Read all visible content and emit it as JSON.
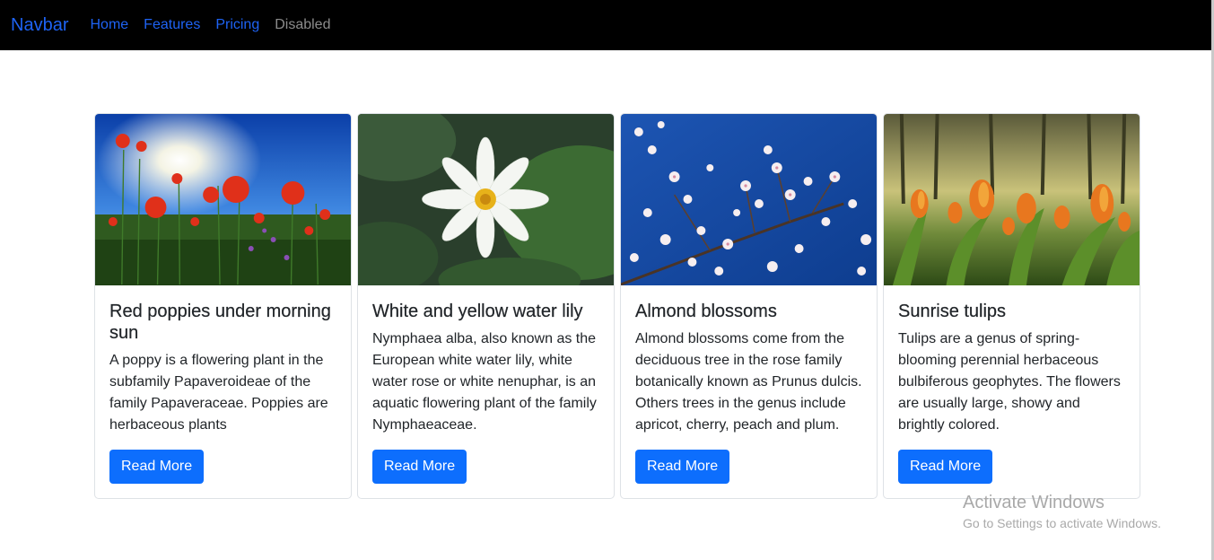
{
  "navbar": {
    "brand": "Navbar",
    "links": [
      "Home",
      "Features",
      "Pricing"
    ],
    "disabled_link": "Disabled"
  },
  "cards": [
    {
      "title": "Red poppies under morning sun",
      "text": "A poppy is a flowering plant in the subfamily Papaveroideae of the family Papaveraceae. Poppies are herbaceous plants",
      "button": "Read More"
    },
    {
      "title": "White and yellow water lily",
      "text": "Nymphaea alba, also known as the European white water lily, white water rose or white nenuphar, is an aquatic flowering plant of the family Nymphaeaceae.",
      "button": "Read More"
    },
    {
      "title": "Almond blossoms",
      "text": "Almond blossoms come from the deciduous tree in the rose family botanically known as Prunus dulcis. Others trees in the genus include apricot, cherry, peach and plum.",
      "button": "Read More"
    },
    {
      "title": "Sunrise tulips",
      "text": "Tulips are a genus of spring-blooming perennial herbaceous bulbiferous geophytes. The flowers are usually large, showy and brightly colored.",
      "button": "Read More"
    }
  ],
  "watermark": {
    "title": "Activate Windows",
    "subtitle": "Go to Settings to activate Windows."
  },
  "colors": {
    "navbar_bg": "#000000",
    "link": "#1e63f4",
    "button": "#0d6efd"
  }
}
